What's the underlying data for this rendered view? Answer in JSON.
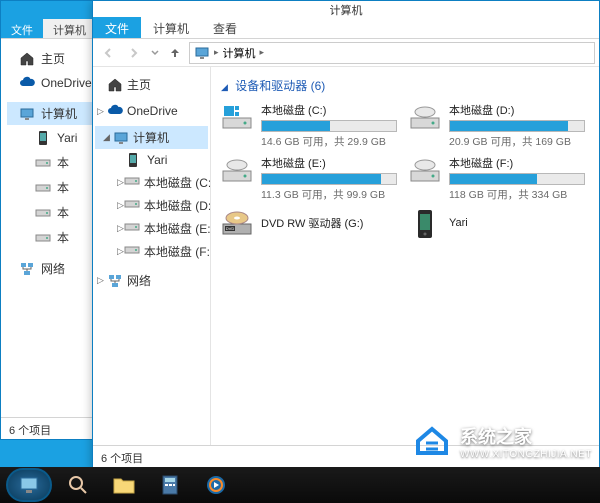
{
  "ribbon": {
    "file": "文件",
    "computer": "计算机",
    "view": "查看"
  },
  "window_title": "计算机",
  "nav": {
    "home": "主页",
    "onedrive": "OneDrive",
    "computer": "计算机",
    "yari": "Yari",
    "disk_c": "本地磁盘 (C:)",
    "disk_d": "本地磁盘 (D:)",
    "disk_e": "本地磁盘 (E:)",
    "disk_f": "本地磁盘 (F:)",
    "network": "网络"
  },
  "breadcrumb": "计算机",
  "section": {
    "title": "设备和驱动器 (6)"
  },
  "drives": [
    {
      "name": "本地磁盘 (C:)",
      "free": "14.6 GB 可用，共 29.9 GB",
      "fill": 51
    },
    {
      "name": "本地磁盘 (D:)",
      "free": "20.9 GB 可用，共 169 GB",
      "fill": 88
    },
    {
      "name": "本地磁盘 (E:)",
      "free": "11.3 GB 可用，共 99.9 GB",
      "fill": 89
    },
    {
      "name": "本地磁盘 (F:)",
      "free": "118 GB 可用，共 334 GB",
      "fill": 65
    }
  ],
  "dvd": {
    "name": "DVD RW 驱动器 (G:)"
  },
  "phone": {
    "name": "Yari"
  },
  "status": {
    "items": "6 个项目"
  },
  "watermark": {
    "text": "系统之家",
    "url": "WWW.XITONGZHIJIA.NET"
  }
}
